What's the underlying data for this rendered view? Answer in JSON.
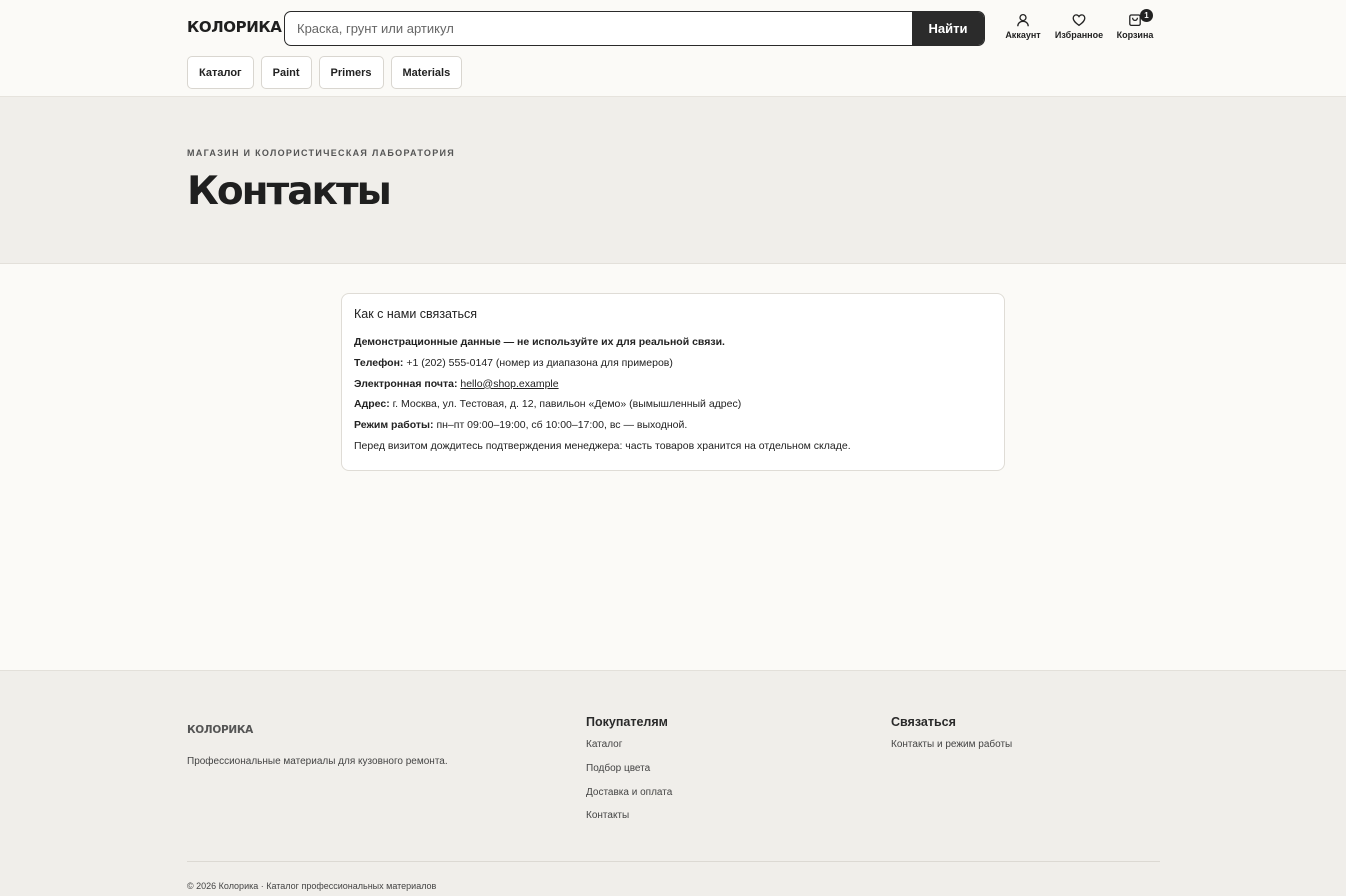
{
  "header": {
    "logo": "КОЛОРИКА",
    "search": {
      "placeholder": "Краска, грунт или артикул",
      "button": "Найти"
    },
    "account": "Аккаунт",
    "favorites": "Избранное",
    "cart": "Корзина",
    "cart_count": "1",
    "nav": [
      "Каталог",
      "Paint",
      "Primers",
      "Materials"
    ]
  },
  "hero": {
    "eyebrow": "МАГАЗИН И КОЛОРИСТИЧЕСКАЯ ЛАБОРАТОРИЯ",
    "title": "Контакты"
  },
  "contact": {
    "heading": "Как с нами связаться",
    "disclaimer": "Демонстрационные данные — не используйте их для реальной связи.",
    "phone_label": "Телефон:",
    "phone_value": " +1 (202) 555-0147 (номер из диапазона для примеров)",
    "email_label": "Электронная почта:",
    "email_value": "hello@shop.example",
    "address_label": "Адрес:",
    "address_value": " г. Москва, ул. Тестовая, д. 12, павильон «Демо» (вымышленный адрес)",
    "hours_label": "Режим работы:",
    "hours_value": " пн–пт 09:00–19:00, сб 10:00–17:00, вс — выходной.",
    "note": "Перед визитом дождитесь подтверждения менеджера: часть товаров хранится на отдельном складе."
  },
  "footer": {
    "logo": "КОЛОРИКА",
    "tagline": "Профессиональные материалы для кузовного ремонта.",
    "col1": {
      "title": "Покупателям",
      "links": [
        "Каталог",
        "Подбор цвета",
        "Доставка и оплата",
        "Контакты"
      ]
    },
    "col2": {
      "title": "Связаться",
      "links": [
        "Контакты и режим работы"
      ]
    },
    "copyright": "© 2026 Колорика · Каталог профессиональных материалов"
  },
  "icons": {
    "account": "user-icon",
    "favorites": "heart-icon",
    "cart": "bag-icon"
  }
}
